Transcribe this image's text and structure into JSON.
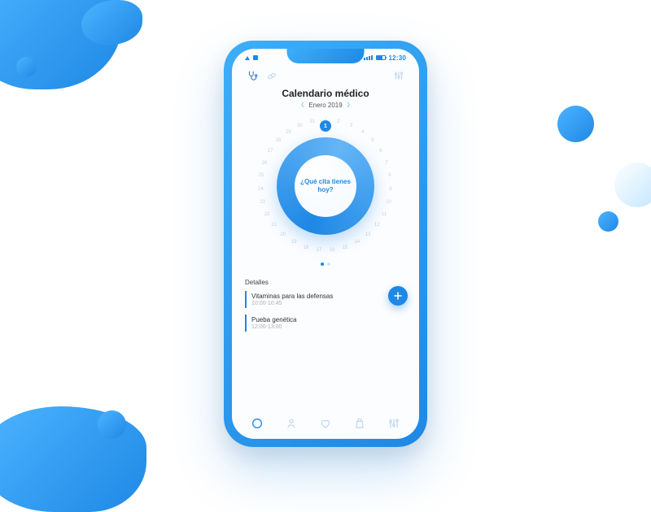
{
  "status": {
    "time": "12:30"
  },
  "header": {
    "title": "Calendario médico",
    "month": "Enero 2019"
  },
  "dial": {
    "prompt": "¿Qué cita tienes hoy?",
    "selected_day": "1"
  },
  "details": {
    "heading": "Detalles",
    "events": [
      {
        "title": "Vitaminas para las defensas",
        "time": "10:00-10:45"
      },
      {
        "title": "Pueba genética",
        "time": "12:00-13:00"
      }
    ]
  },
  "colors": {
    "accent": "#1e88e5"
  }
}
